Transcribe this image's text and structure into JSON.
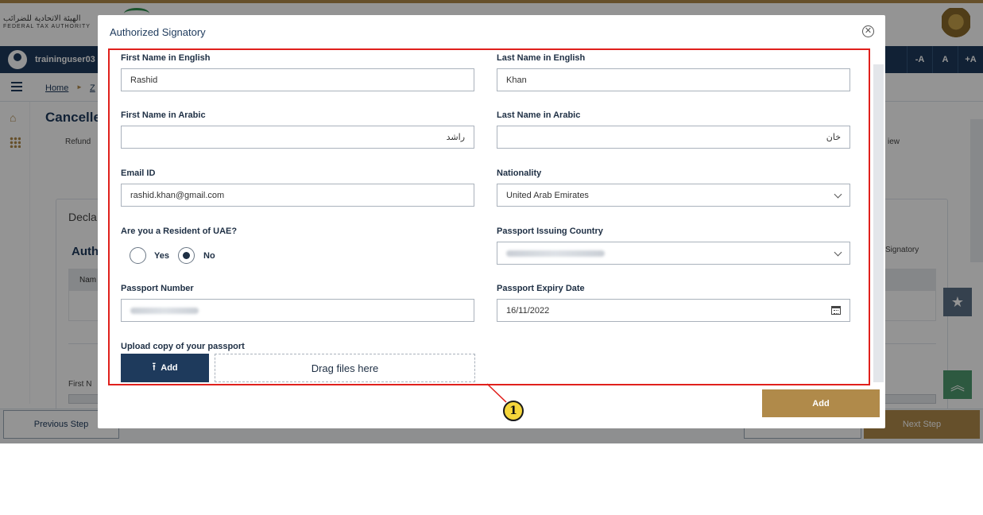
{
  "header": {
    "logo_arabic": "الهيئة الاتحادية للضرائب",
    "logo_english": "FEDERAL TAX AUTHORITY"
  },
  "userbar": {
    "username": "traininguser03",
    "font_controls": [
      "-A",
      "A",
      "+A"
    ]
  },
  "breadcrumb": {
    "home": "Home",
    "next": "Z",
    "separator": "►"
  },
  "page": {
    "title": "Cancelle",
    "refund_tab": "Refund",
    "review_tab": "iew",
    "declaration_title": "Decla",
    "authorized_title": "Auth",
    "signatory_header": "Signatory",
    "table_name_header": "Nam",
    "first_name_label": "First N"
  },
  "bottom_bar": {
    "previous": "Previous Step",
    "next": "Next Step"
  },
  "modal": {
    "title": "Authorized Signatory",
    "close_glyph": "✕",
    "fields": {
      "first_name_en": {
        "label": "First Name in English",
        "value": "Rashid"
      },
      "last_name_en": {
        "label": "Last Name in English",
        "value": "Khan"
      },
      "first_name_ar": {
        "label": "First Name in Arabic",
        "value": "راشد"
      },
      "last_name_ar": {
        "label": "Last Name in Arabic",
        "value": "خان"
      },
      "email": {
        "label": "Email ID",
        "value": "rashid.khan@gmail.com"
      },
      "nationality": {
        "label": "Nationality",
        "value": "United Arab Emirates"
      },
      "resident": {
        "label": "Are you a Resident of UAE?",
        "options": [
          "Yes",
          "No"
        ],
        "selected": "No"
      },
      "passport_country": {
        "label": "Passport Issuing Country",
        "value": ""
      },
      "passport_number": {
        "label": "Passport Number",
        "value": ""
      },
      "passport_expiry": {
        "label": "Passport Expiry Date",
        "value": "16/11/2022"
      },
      "passport_upload": {
        "label": "Upload copy of your passport",
        "add_label": "Add",
        "drop_label": "Drag files here"
      }
    },
    "add_button": "Add"
  },
  "annotation": {
    "marker": "1",
    "highlight_color": "#e0201c",
    "marker_color": "#f5d63b"
  },
  "colors": {
    "brand_navy": "#1e3a5c",
    "brand_gold": "#b08a4a"
  }
}
